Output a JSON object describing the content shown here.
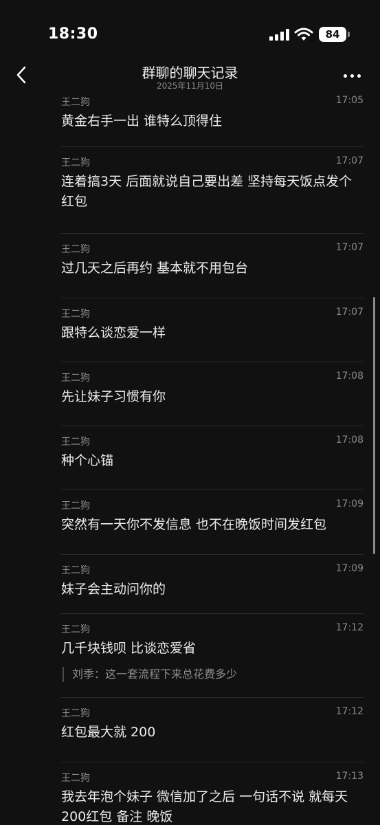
{
  "status_bar": {
    "time": "18:30",
    "battery": "84"
  },
  "header": {
    "title": "群聊的聊天记录",
    "subtitle": "2025年11月10日"
  },
  "messages": [
    {
      "sender": "王二狗",
      "time": "17:05",
      "text": "黄金右手一出 谁特么顶得住"
    },
    {
      "sender": "王二狗",
      "time": "17:07",
      "text": "连着搞3天 后面就说自己要出差 坚持每天饭点发个红包"
    },
    {
      "sender": "王二狗",
      "time": "17:07",
      "text": "过几天之后再约 基本就不用包台"
    },
    {
      "sender": "王二狗",
      "time": "17:07",
      "text": "跟特么谈恋爱一样"
    },
    {
      "sender": "王二狗",
      "time": "17:08",
      "text": "先让妹子习惯有你"
    },
    {
      "sender": "王二狗",
      "time": "17:08",
      "text": "种个心锚"
    },
    {
      "sender": "王二狗",
      "time": "17:09",
      "text": "突然有一天你不发信息 也不在晚饭时间发红包"
    },
    {
      "sender": "王二狗",
      "time": "17:09",
      "text": "妹子会主动问你的"
    },
    {
      "sender": "王二狗",
      "time": "17:12",
      "text": "几千块钱呗 比谈恋爱省",
      "quote": "刘季：这一套流程下来总花费多少"
    },
    {
      "sender": "王二狗",
      "time": "17:12",
      "text": "红包最大就 200"
    },
    {
      "sender": "王二狗",
      "time": "17:13",
      "text": "我去年泡个妹子 微信加了之后 一句话不说 就每天200红包 备注 晚饭"
    }
  ]
}
